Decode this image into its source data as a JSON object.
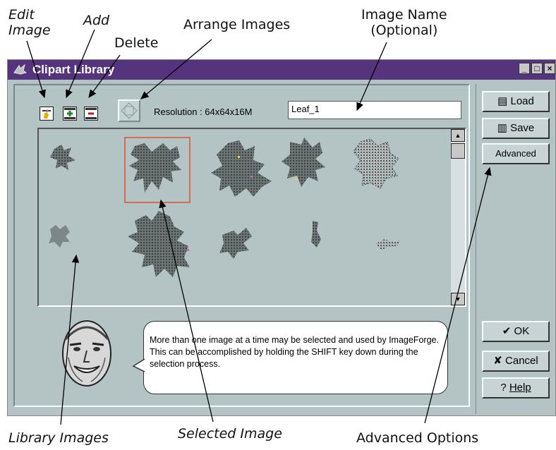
{
  "annotations": {
    "edit_image": [
      "Edit",
      "Image"
    ],
    "add": "Add",
    "delete": "Delete",
    "arrange_images": "Arrange Images",
    "image_name": [
      "Image Name",
      "(Optional)"
    ],
    "library_images": "Library Images",
    "selected_image": "Selected Image",
    "advanced_options": "Advanced Options"
  },
  "window": {
    "title": "Clipart Library",
    "controls": [
      "_",
      "□",
      "×"
    ]
  },
  "toolbar": {
    "resolution_label": "Resolution :",
    "resolution_value": "64x64x16M"
  },
  "image_name_field": {
    "value": "Leaf_1"
  },
  "gallery": {
    "selected_index": 1,
    "scrollbar": {
      "up": "▲",
      "down": "▼"
    }
  },
  "help_bubble": {
    "text": "More than one image at a time may be selected and used by ImageForge. This can be accomplished by holding the SHIFT key down during the selection process."
  },
  "buttons": {
    "load": "Load",
    "save": "Save",
    "advanced": "Advanced",
    "ok": "OK",
    "cancel": "Cancel",
    "help": "Help"
  },
  "icons": {
    "load": "folder-load-icon",
    "save": "disk-save-icon",
    "ok": "checkmark-icon",
    "cancel": "x-icon",
    "help": "question-icon"
  }
}
